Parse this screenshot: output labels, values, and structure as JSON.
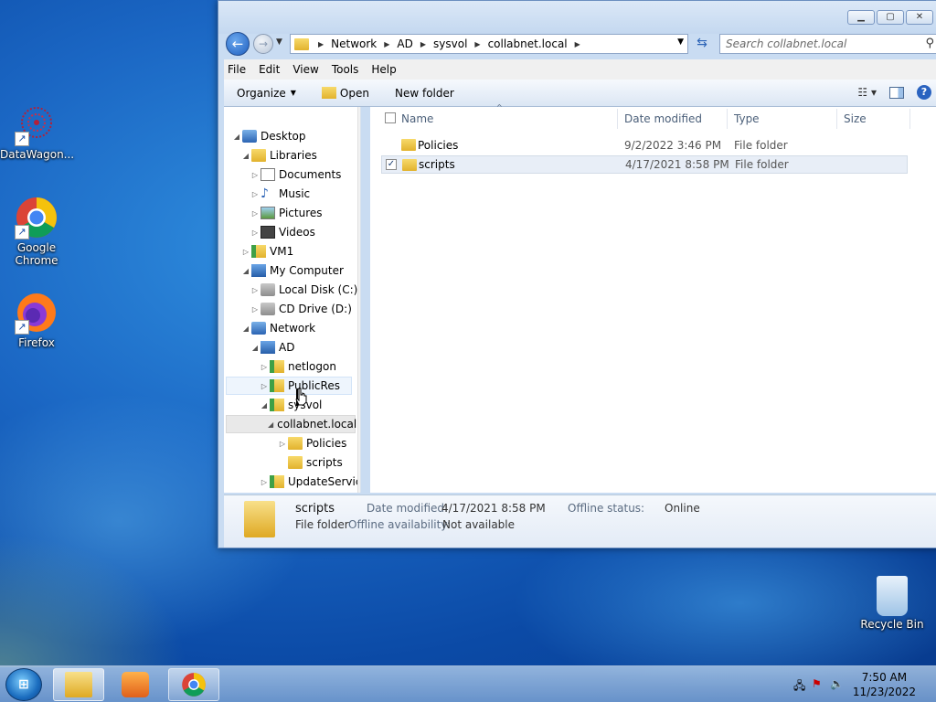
{
  "desktop": {
    "icons": [
      {
        "label": "DataWagon..."
      },
      {
        "label": "Google Chrome"
      },
      {
        "label": "Firefox"
      },
      {
        "label": "Recycle Bin"
      }
    ]
  },
  "window": {
    "address": {
      "segments": [
        "Network",
        "AD",
        "sysvol",
        "collabnet.local"
      ]
    },
    "search": {
      "placeholder": "Search collabnet.local"
    },
    "menu": [
      "File",
      "Edit",
      "View",
      "Tools",
      "Help"
    ],
    "commands": {
      "organize": "Organize",
      "open": "Open",
      "new_folder": "New folder"
    },
    "tree": [
      {
        "label": "Desktop"
      },
      {
        "label": "Libraries"
      },
      {
        "label": "Documents"
      },
      {
        "label": "Music"
      },
      {
        "label": "Pictures"
      },
      {
        "label": "Videos"
      },
      {
        "label": "VM1"
      },
      {
        "label": "My Computer"
      },
      {
        "label": "Local Disk (C:)"
      },
      {
        "label": "CD Drive (D:)"
      },
      {
        "label": "Network"
      },
      {
        "label": "AD"
      },
      {
        "label": "netlogon"
      },
      {
        "label": "PublicRes"
      },
      {
        "label": "sysvol"
      },
      {
        "label": "collabnet.local"
      },
      {
        "label": "Policies"
      },
      {
        "label": "scripts"
      },
      {
        "label": "UpdateServic"
      }
    ],
    "columns": {
      "name": "Name",
      "date": "Date modified",
      "type": "Type",
      "size": "Size"
    },
    "files": [
      {
        "name": "Policies",
        "date": "9/2/2022 3:46 PM",
        "type": "File folder"
      },
      {
        "name": "scripts",
        "date": "4/17/2021 8:58 PM",
        "type": "File folder"
      }
    ],
    "details": {
      "name": "scripts",
      "kind": "File folder",
      "date_label": "Date modified:",
      "date_value": "4/17/2021 8:58 PM",
      "offline_status_label": "Offline status:",
      "offline_status_value": "Online",
      "offline_avail_label": "Offline availability:",
      "offline_avail_value": "Not available"
    }
  },
  "taskbar": {
    "time": "7:50 AM",
    "date": "11/23/2022"
  }
}
